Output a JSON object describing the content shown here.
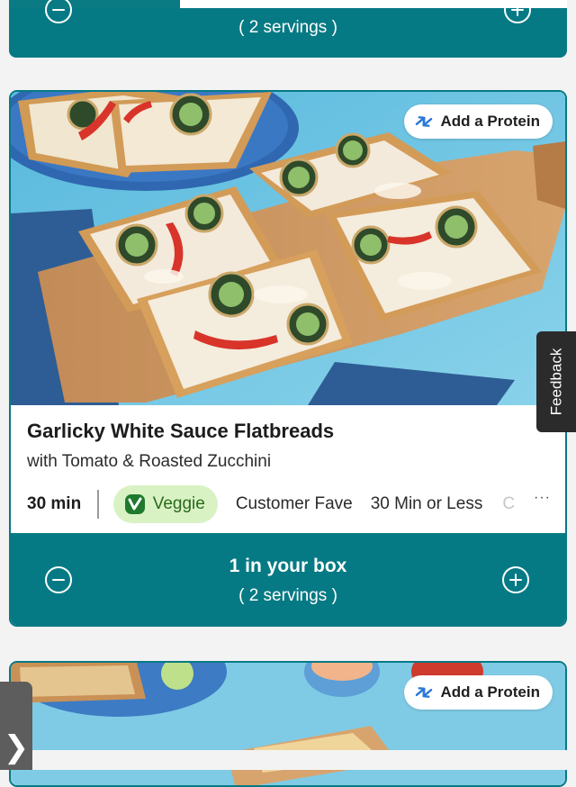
{
  "top_card": {
    "servings": "( 2 servings )",
    "minus_icon": "minus-circle-icon",
    "plus_icon": "plus-circle-icon"
  },
  "recipe": {
    "add_protein_label": "Add a Protein",
    "title": "Garlicky White Sauce Flatbreads",
    "subtitle": "with Tomato & Roasted Zucchini",
    "time": "30 min",
    "veggie_tag": "Veggie",
    "tags": [
      "Customer Fave",
      "30 Min or Less",
      "C"
    ],
    "more": "···",
    "box_count": "1 in your box",
    "servings": "( 2 servings )",
    "colors": {
      "accent": "#067a84",
      "veggie_bg": "#d9f2c4",
      "veggie_text": "#2a6a1c"
    }
  },
  "feedback": {
    "label": "Feedback"
  },
  "next_card": {
    "add_protein_label": "Add a Protein"
  },
  "side_arrow": {
    "label": "❯"
  }
}
